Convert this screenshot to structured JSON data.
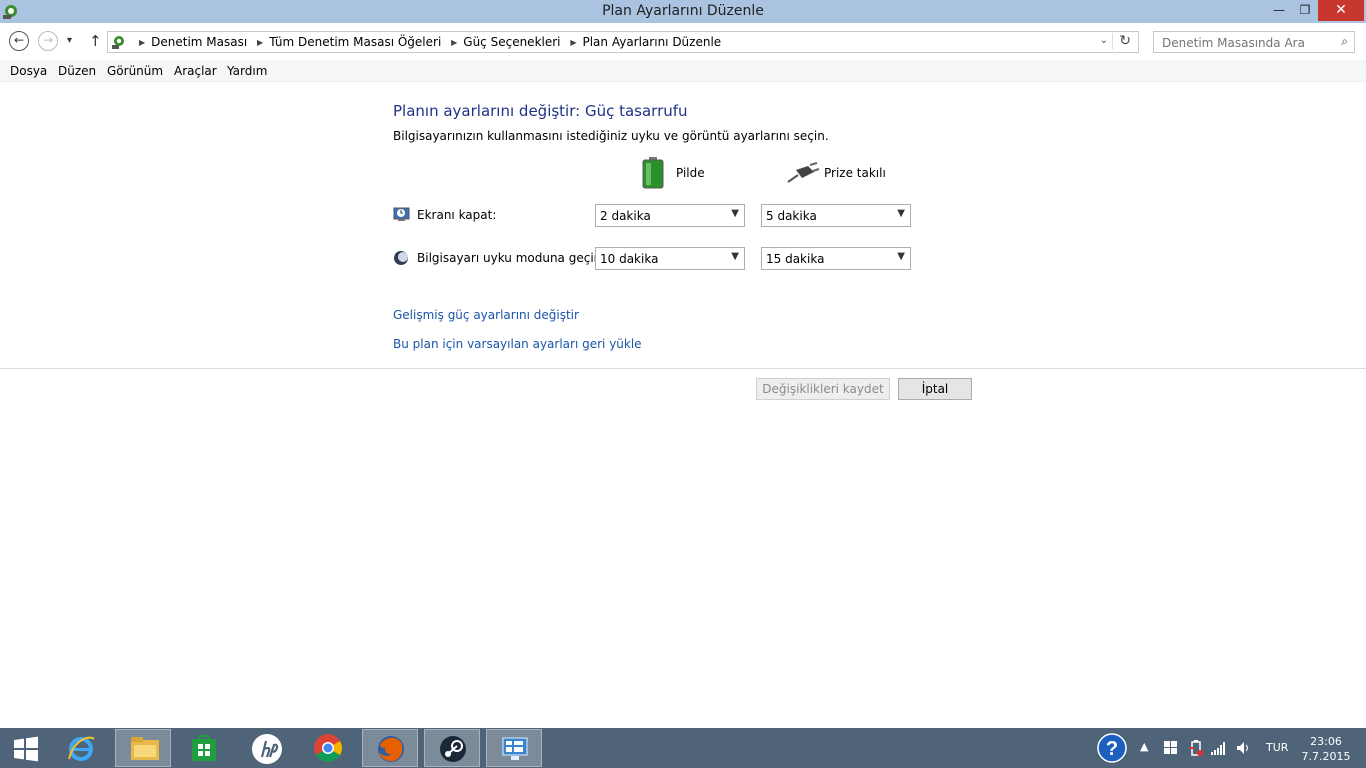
{
  "window": {
    "title": "Plan Ayarlarını Düzenle",
    "minimize_glyph": "—",
    "maximize_glyph": "❐",
    "close_glyph": "✕"
  },
  "nav": {
    "back_glyph": "←",
    "forward_glyph": "→",
    "recent_glyph": "▾",
    "up_glyph": "↑",
    "breadcrumbs": [
      "Denetim Masası",
      "Tüm Denetim Masası Öğeleri",
      "Güç Seçenekleri",
      "Plan Ayarlarını Düzenle"
    ],
    "search_placeholder": "Denetim Masasında Ara"
  },
  "menu": {
    "items": [
      "Dosya",
      "Düzen",
      "Görünüm",
      "Araçlar",
      "Yardım"
    ]
  },
  "content": {
    "heading": "Planın ayarlarını değiştir: Güç tasarrufu",
    "subtitle": "Bilgisayarınızın kullanmasını istediğiniz uyku ve görüntü ayarlarını seçin.",
    "col_battery": "Pilde",
    "col_plugged": "Prize takılı",
    "rows": [
      {
        "label": "Ekranı kapat:",
        "battery": "2 dakika",
        "plugged": "5 dakika"
      },
      {
        "label": "Bilgisayarı uyku moduna geçir:",
        "battery": "10 dakika",
        "plugged": "15 dakika"
      }
    ],
    "link_advanced": "Gelişmiş güç ayarlarını değiştir",
    "link_restore": "Bu plan için varsayılan ayarları geri yükle",
    "save_label": "Değişiklikleri kaydet",
    "cancel_label": "İptal"
  },
  "taskbar": {
    "lang": "TUR",
    "time": "23:06",
    "date": "7.7.2015",
    "apps": [
      "start-icon",
      "internet-explorer-icon",
      "file-explorer-icon",
      "store-icon",
      "hp-icon",
      "chrome-icon",
      "firefox-icon",
      "steam-icon",
      "control-panel-icon"
    ]
  },
  "colors": {
    "titlebar": "#a9c3e0",
    "heading": "#1e3287",
    "link": "#1a55a8",
    "taskbar": "#4f6478",
    "close": "#c7372e"
  }
}
